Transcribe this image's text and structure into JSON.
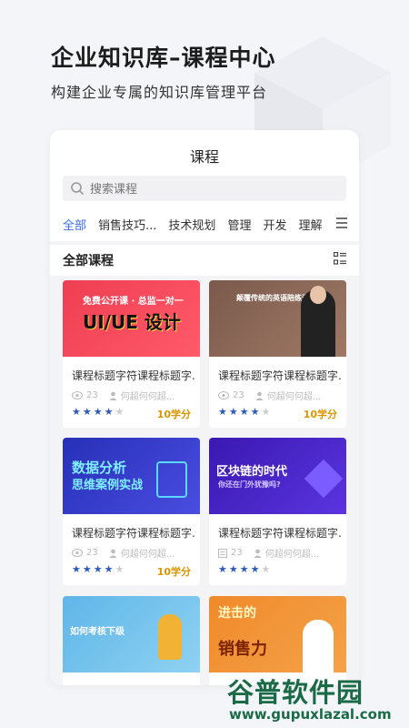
{
  "hero": {
    "title": "企业知识库–课程中心",
    "subtitle": "构建企业专属的知识库管理平台"
  },
  "screen": {
    "title": "课程",
    "search_placeholder": "搜索课程",
    "tabs": [
      "全部",
      "销售技巧...",
      "技术规划",
      "管理",
      "开发",
      "理解"
    ],
    "active_tab": "全部",
    "section_title": "全部课程"
  },
  "courses": [
    {
      "banner_line1": "免费公开课 · 总监一对一",
      "banner_line2": "UI/UE 设计",
      "title": "课程标题字符课程标题字...",
      "views": "23",
      "author": "何超何何超...",
      "rating": 4,
      "points": "10学分",
      "colors": [
        "#ef3e52",
        "#ff5a6a"
      ]
    },
    {
      "banner_line1": "颠覆传统的英语陪练课",
      "banner_line2": "",
      "title": "课程标题字符课程标题字...",
      "views": "23",
      "author": "何超何何超...",
      "rating": 4,
      "points": "10学分",
      "colors": [
        "#7a5a4c",
        "#a07966"
      ]
    },
    {
      "banner_line1": "数据分析",
      "banner_line2": "思维案例实战",
      "title": "课程标题字符课程标题字...",
      "views": "23",
      "author": "何超何何超...",
      "rating": 4,
      "points": "10学分",
      "colors": [
        "#2730b8",
        "#4a4de0"
      ]
    },
    {
      "banner_line1": "区块链的时代",
      "banner_line2": "你还在门外犹豫吗?",
      "title": "课程标题字符课程标题字...",
      "views": "23",
      "author": "何超何何超...",
      "rating": 4,
      "points": "",
      "colors": [
        "#3a18b0",
        "#5a35e0"
      ]
    },
    {
      "banner_line1": "如何考核下级",
      "banner_line2": "",
      "title": "",
      "views": "",
      "author": "",
      "rating": 0,
      "points": "",
      "colors": [
        "#5fb6e8",
        "#8fd2f2"
      ]
    },
    {
      "banner_line1": "进击的",
      "banner_line2": "销售力",
      "title": "",
      "views": "",
      "author": "",
      "rating": 0,
      "points": "",
      "colors": [
        "#f08a2a",
        "#f4a24a"
      ]
    }
  ],
  "watermark": {
    "cn": "谷普软件园",
    "url": "www.gupuxlazal.com"
  },
  "colors": {
    "accent": "#3b6ee8",
    "star": "#2d5bb8",
    "points": "#d89600"
  }
}
